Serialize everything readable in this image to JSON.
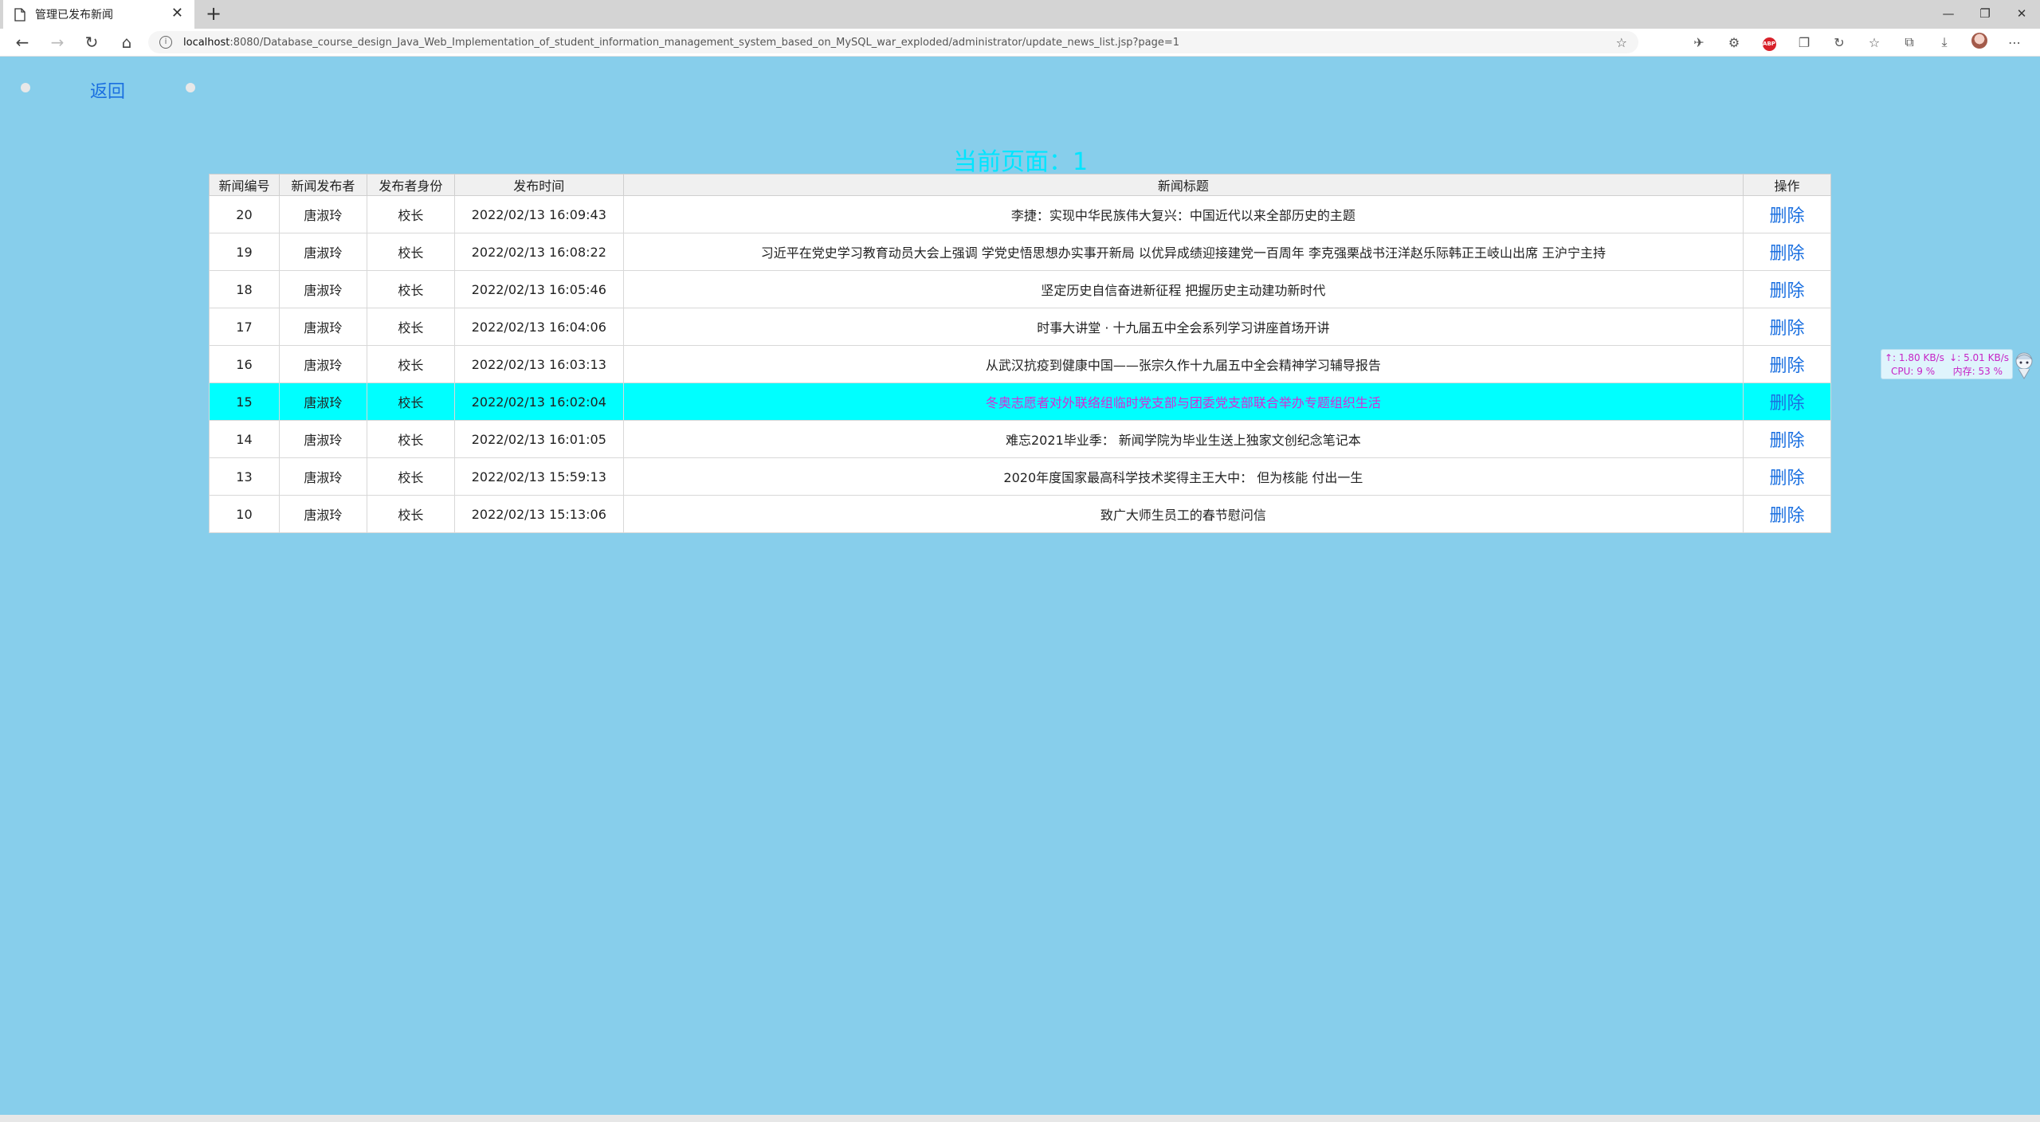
{
  "browser": {
    "tab_title": "管理已发布新闻",
    "tab_close": "✕",
    "new_tab": "+",
    "url_host": "localhost",
    "url_rest": ":8080/Database_course_design_Java_Web_Implementation_of_student_information_management_system_based_on_MySQL_war_exploded/administrator/update_news_list.jsp?page=1",
    "window_controls": [
      "—",
      "❐",
      "✕"
    ]
  },
  "page": {
    "back_label": "返回",
    "page_indicator": "当前页面：1"
  },
  "table": {
    "headers": [
      "新闻编号",
      "新闻发布者",
      "发布者身份",
      "发布时间",
      "新闻标题",
      "操作"
    ],
    "rows": [
      {
        "id": "20",
        "publisher": "唐淑玲",
        "role": "校长",
        "time": "2022/02/13 16:09:43",
        "title": "李捷：实现中华民族伟大复兴：中国近代以来全部历史的主题",
        "action": "删除"
      },
      {
        "id": "19",
        "publisher": "唐淑玲",
        "role": "校长",
        "time": "2022/02/13 16:08:22",
        "title": "习近平在党史学习教育动员大会上强调 学党史悟思想办实事开新局 以优异成绩迎接建党一百周年 李克强栗战书汪洋赵乐际韩正王岐山出席 王沪宁主持",
        "action": "删除"
      },
      {
        "id": "18",
        "publisher": "唐淑玲",
        "role": "校长",
        "time": "2022/02/13 16:05:46",
        "title": "坚定历史自信奋进新征程 把握历史主动建功新时代",
        "action": "删除"
      },
      {
        "id": "17",
        "publisher": "唐淑玲",
        "role": "校长",
        "time": "2022/02/13 16:04:06",
        "title": "时事大讲堂 · 十九届五中全会系列学习讲座首场开讲",
        "action": "删除"
      },
      {
        "id": "16",
        "publisher": "唐淑玲",
        "role": "校长",
        "time": "2022/02/13 16:03:13",
        "title": "从武汉抗疫到健康中国——张宗久作十九届五中全会精神学习辅导报告",
        "action": "删除"
      },
      {
        "id": "15",
        "publisher": "唐淑玲",
        "role": "校长",
        "time": "2022/02/13 16:02:04",
        "title": "冬奥志愿者对外联络组临时党支部与团委党支部联合举办专题组织生活",
        "action": "删除",
        "highlight": true
      },
      {
        "id": "14",
        "publisher": "唐淑玲",
        "role": "校长",
        "time": "2022/02/13 16:01:05",
        "title": "难忘2021毕业季： 新闻学院为毕业生送上独家文创纪念笔记本",
        "action": "删除"
      },
      {
        "id": "13",
        "publisher": "唐淑玲",
        "role": "校长",
        "time": "2022/02/13 15:59:13",
        "title": "2020年度国家最高科学技术奖得主王大中： 但为核能 付出一生",
        "action": "删除"
      },
      {
        "id": "10",
        "publisher": "唐淑玲",
        "role": "校长",
        "time": "2022/02/13 15:13:06",
        "title": "致广大师生员工的春节慰问信",
        "action": "删除"
      }
    ]
  },
  "net_monitor": {
    "upload": "↑: 1.80 KB/s",
    "download": "↓: 5.01 KB/s",
    "cpu": "CPU: 9 %",
    "memory": "内存: 53 %"
  },
  "colors": {
    "page_background": "#87ceeb",
    "highlight_row": "#00ffff",
    "highlight_text": "#d62bd6",
    "link": "#1a6fe0",
    "page_indicator": "#00e5ff"
  }
}
